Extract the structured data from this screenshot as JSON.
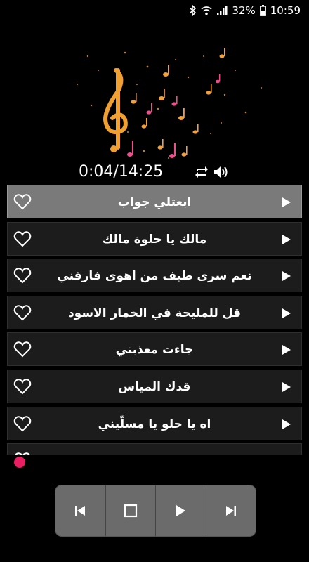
{
  "status_bar": {
    "battery": "32%",
    "time": "10:59"
  },
  "player": {
    "elapsed_total": "0:04/14:25"
  },
  "songs": [
    {
      "title": "ابعتلي جواب",
      "active": true
    },
    {
      "title": "مالك يا حلوة مالك",
      "active": false
    },
    {
      "title": "نعم سرى طيف من اهوى فارقني",
      "active": false
    },
    {
      "title": "قل للمليحة في الخمار الاسود",
      "active": false
    },
    {
      "title": "جاءت معذبتي",
      "active": false
    },
    {
      "title": "قدك المياس",
      "active": false
    },
    {
      "title": "اه يا حلو يا مسلّيني",
      "active": false
    },
    {
      "title": "",
      "active": false
    }
  ],
  "colors": {
    "active_row": "#7a7a7a",
    "row": "#1c1c1c",
    "progress_dot": "#e91e63",
    "controls_bg": "#6b6b6b"
  }
}
